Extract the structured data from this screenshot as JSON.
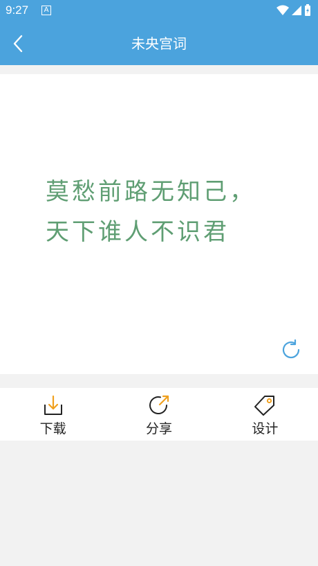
{
  "status_bar": {
    "time": "9:27",
    "app_badge": "A"
  },
  "header": {
    "title": "未央宫词"
  },
  "poem": {
    "text": "莫愁前路无知己，天下谁人不识君"
  },
  "actions": [
    {
      "label": "下载",
      "icon": "download-icon"
    },
    {
      "label": "分享",
      "icon": "share-icon"
    },
    {
      "label": "设计",
      "icon": "tag-icon"
    }
  ],
  "colors": {
    "primary": "#4ba3dd",
    "poem_text": "#5f9e73",
    "accent_orange": "#f0a01e"
  }
}
